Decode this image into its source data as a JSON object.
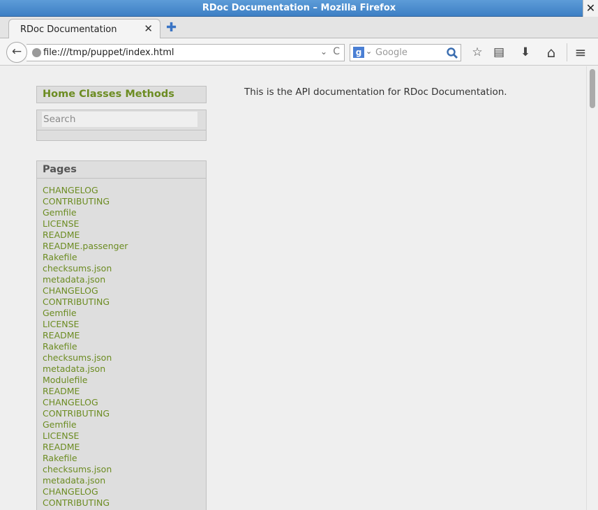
{
  "window": {
    "title": "RDoc Documentation – Mozilla Firefox",
    "close_glyph": "✕"
  },
  "tabs": [
    {
      "label": "RDoc Documentation",
      "close_glyph": "✕"
    }
  ],
  "toolbar": {
    "new_tab_glyph": "✚",
    "back_glyph": "←",
    "url": "file:///tmp/puppet/index.html",
    "url_dropdown_glyph": "⌄",
    "reload_glyph": "C",
    "search_engine_letter": "g",
    "search_engine_drop_glyph": "⌄",
    "search_placeholder": "Google",
    "bookmark_glyph": "☆",
    "reading_list_glyph": "▤",
    "download_glyph": "⬇",
    "home_glyph": "⌂",
    "menu_glyph": "≡"
  },
  "sidebar": {
    "nav": {
      "home": "Home",
      "classes": "Classes",
      "methods": "Methods"
    },
    "search_placeholder": "Search",
    "pages_heading": "Pages",
    "pages": [
      "CHANGELOG",
      "CONTRIBUTING",
      "Gemfile",
      "LICENSE",
      "README",
      "README.passenger",
      "Rakefile",
      "checksums.json",
      "metadata.json",
      "CHANGELOG",
      "CONTRIBUTING",
      "Gemfile",
      "LICENSE",
      "README",
      "Rakefile",
      "checksums.json",
      "metadata.json",
      "Modulefile",
      "README",
      "CHANGELOG",
      "CONTRIBUTING",
      "Gemfile",
      "LICENSE",
      "README",
      "Rakefile",
      "checksums.json",
      "metadata.json",
      "CHANGELOG",
      "CONTRIBUTING"
    ]
  },
  "main": {
    "intro": "This is the API documentation for RDoc Documentation."
  }
}
